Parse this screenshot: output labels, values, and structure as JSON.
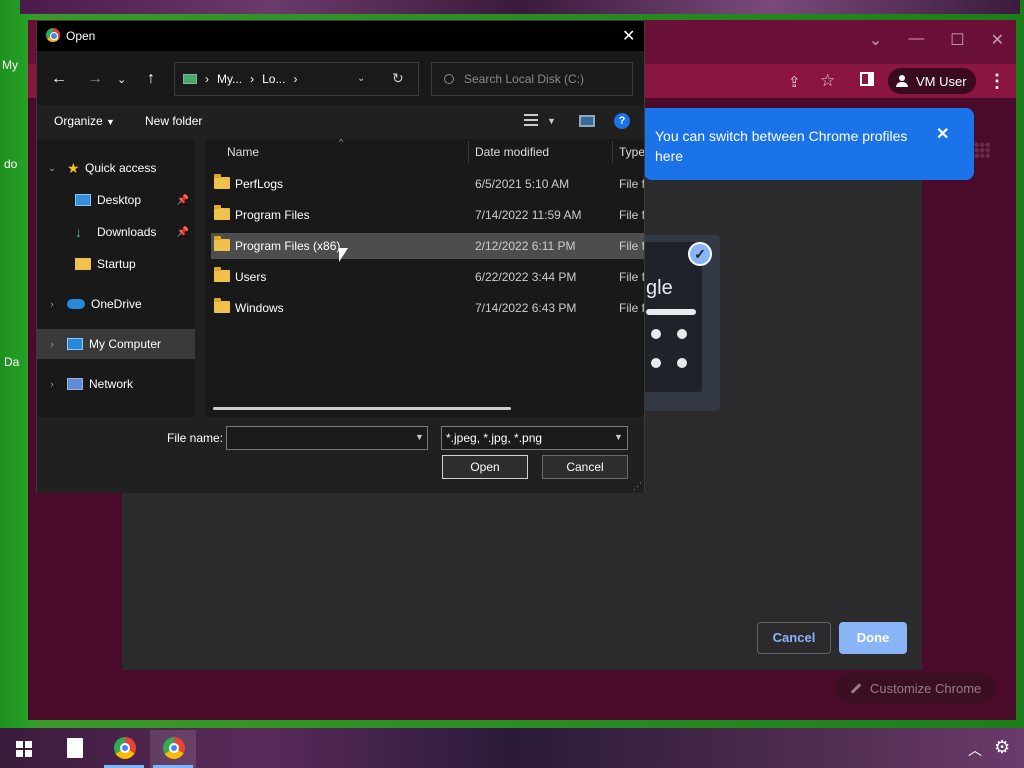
{
  "desktop": {
    "labels": [
      "My",
      "do",
      "Da"
    ]
  },
  "chrome": {
    "profile_name": "VM User",
    "bubble_text": "You can switch between Chrome profiles here",
    "card_text": "gle",
    "cancel_label": "Cancel",
    "done_label": "Done",
    "customize_label": "Customize Chrome",
    "colors": {
      "bubble": "#1a73e8",
      "done": "#8ab4f8"
    }
  },
  "dialog": {
    "title": "Open",
    "address": {
      "segments": [
        "My...",
        "Lo..."
      ]
    },
    "search_placeholder": "Search Local Disk (C:)",
    "toolbar": {
      "organize": "Organize",
      "new_folder": "New folder",
      "help": "?"
    },
    "nav": {
      "items": [
        {
          "label": "Quick access",
          "icon": "star-icon",
          "expanded": true
        },
        {
          "label": "Desktop",
          "icon": "desktop-icon",
          "pinned": true
        },
        {
          "label": "Downloads",
          "icon": "download-icon",
          "pinned": true
        },
        {
          "label": "Startup",
          "icon": "folder-icon"
        },
        {
          "label": "OneDrive",
          "icon": "cloud-icon"
        },
        {
          "label": "My Computer",
          "icon": "computer-icon",
          "selected": true
        },
        {
          "label": "Network",
          "icon": "network-icon"
        }
      ]
    },
    "columns": {
      "name": "Name",
      "date": "Date modified",
      "type": "Type"
    },
    "files": [
      {
        "name": "PerfLogs",
        "date": "6/5/2021 5:10 AM",
        "type": "File fo"
      },
      {
        "name": "Program Files",
        "date": "7/14/2022 11:59 AM",
        "type": "File fo"
      },
      {
        "name": "Program Files (x86)",
        "date": "2/12/2022 6:11 PM",
        "type": "File fo",
        "hover": true
      },
      {
        "name": "Users",
        "date": "6/22/2022 3:44 PM",
        "type": "File fo"
      },
      {
        "name": "Windows",
        "date": "7/14/2022 6:43 PM",
        "type": "File fo"
      }
    ],
    "footer": {
      "filename_label": "File name:",
      "filename_value": "",
      "filetype": "*.jpeg, *.jpg, *.png",
      "open": "Open",
      "cancel": "Cancel"
    }
  }
}
